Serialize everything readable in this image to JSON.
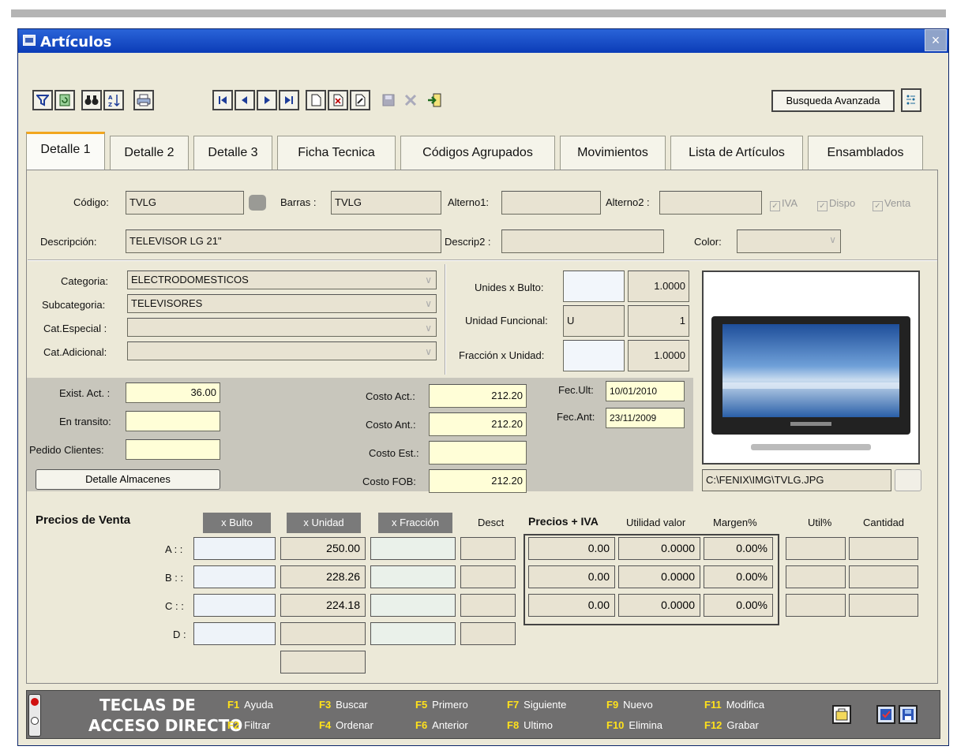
{
  "window": {
    "title": "Artículos",
    "close_glyph": "×"
  },
  "toolbar": {
    "buttons": [
      {
        "name": "filter-icon"
      },
      {
        "name": "refresh-icon"
      },
      {
        "name": "binoculars-icon"
      },
      {
        "name": "sort-icon"
      },
      {
        "name": "printer-icon"
      },
      {
        "name": "first-record-icon"
      },
      {
        "name": "previous-record-icon"
      },
      {
        "name": "next-record-icon"
      },
      {
        "name": "last-record-icon"
      },
      {
        "name": "new-record-icon"
      },
      {
        "name": "delete-record-icon"
      },
      {
        "name": "edit-record-icon"
      },
      {
        "name": "save-icon"
      },
      {
        "name": "cancel-icon"
      },
      {
        "name": "exit-icon"
      },
      {
        "name": "options-icon"
      }
    ],
    "advanced_search": "Busqueda Avanzada"
  },
  "tabs": [
    "Detalle 1",
    "Detalle 2",
    "Detalle 3",
    "Ficha Tecnica",
    "Códigos Agrupados",
    "Movimientos",
    "Lista de Artículos",
    "Ensamblados"
  ],
  "detail": {
    "codigo_label": "Código:",
    "codigo": "TVLG",
    "barras_label": "Barras :",
    "barras": "TVLG",
    "alterno1_label": "Alterno1:",
    "alterno1": "",
    "alterno2_label": "Alterno2 :",
    "alterno2": "",
    "iva": "IVA",
    "dispo": "Dispo",
    "venta": "Venta",
    "descripcion_label": "Descripción:",
    "descripcion": "TELEVISOR LG 21\"",
    "descrip2_label": "Descrip2 :",
    "descrip2": "",
    "color_label": "Color:",
    "color": ""
  },
  "categories": {
    "categoria_label": "Categoria:",
    "categoria": "ELECTRODOMESTICOS",
    "subcategoria_label": "Subcategoria:",
    "subcategoria": "TELEVISORES",
    "catespecial_label": "Cat.Especial :",
    "catespecial": "",
    "catadicional_label": "Cat.Adicional:",
    "catadicional": ""
  },
  "units": {
    "bulto_label": "Unides x Bulto:",
    "bulto_value": "1.0000",
    "funcional_label": "Unidad Funcional:",
    "funcional_code": "U",
    "funcional_value": "1",
    "fraccion_label": "Fracción x Unidad:",
    "fraccion_value": "1.0000"
  },
  "stock": {
    "exist_label": "Exist. Act. :",
    "exist": "36.00",
    "transito_label": "En transito:",
    "transito": "",
    "pedido_label": "Pedido Clientes:",
    "pedido": "",
    "almacenes_button": "Detalle Almacenes"
  },
  "costs": {
    "act_label": "Costo Act.:",
    "act": "212.20",
    "ant_label": "Costo Ant.:",
    "ant": "212.20",
    "est_label": "Costo Est.:",
    "est": "",
    "fob_label": "Costo FOB:",
    "fob": "212.20",
    "fec_ult_label": "Fec.Ult:",
    "fec_ult": "10/01/2010",
    "fec_ant_label": "Fec.Ant:",
    "fec_ant": "23/11/2009"
  },
  "image": {
    "path": "C:\\FENIX\\IMG\\TVLG.JPG"
  },
  "prices": {
    "section_title": "Precios de Venta",
    "headers": {
      "bulto": "x Bulto",
      "unidad": "x Unidad",
      "fraccion": "x Fracción",
      "desct": "Desct",
      "precios_iva": "Precios + IVA",
      "utilidad": "Utilidad valor",
      "margen": "Margen%",
      "util": "Util%",
      "cantidad": "Cantidad"
    },
    "rows": [
      {
        "label": "A : :",
        "bulto": "",
        "unidad": "250.00",
        "fraccion": "",
        "desct": "",
        "precio_iva": "0.00",
        "utilidad": "0.0000",
        "margen": "0.00%",
        "util": "",
        "cantidad": ""
      },
      {
        "label": "B : :",
        "bulto": "",
        "unidad": "228.26",
        "fraccion": "",
        "desct": "",
        "precio_iva": "0.00",
        "utilidad": "0.0000",
        "margen": "0.00%",
        "util": "",
        "cantidad": ""
      },
      {
        "label": "C : :",
        "bulto": "",
        "unidad": "224.18",
        "fraccion": "",
        "desct": "",
        "precio_iva": "0.00",
        "utilidad": "0.0000",
        "margen": "0.00%",
        "util": "",
        "cantidad": ""
      },
      {
        "label": "D :",
        "bulto": "",
        "unidad": "",
        "fraccion": "",
        "desct": ""
      }
    ],
    "extra": ""
  },
  "footer": {
    "title_line1": "TECLAS DE",
    "title_line2": "ACCESO DIRECTO",
    "keys": [
      {
        "key": "F1",
        "label": "Ayuda"
      },
      {
        "key": "F2",
        "label": "Filtrar"
      },
      {
        "key": "F3",
        "label": "Buscar"
      },
      {
        "key": "F4",
        "label": "Ordenar"
      },
      {
        "key": "F5",
        "label": "Primero"
      },
      {
        "key": "F6",
        "label": "Anterior"
      },
      {
        "key": "F7",
        "label": "Siguiente"
      },
      {
        "key": "F8",
        "label": "Ultimo"
      },
      {
        "key": "F9",
        "label": "Nuevo"
      },
      {
        "key": "F10",
        "label": "Elimina"
      },
      {
        "key": "F11",
        "label": "Modifica"
      },
      {
        "key": "F12",
        "label": "Grabar"
      }
    ]
  }
}
